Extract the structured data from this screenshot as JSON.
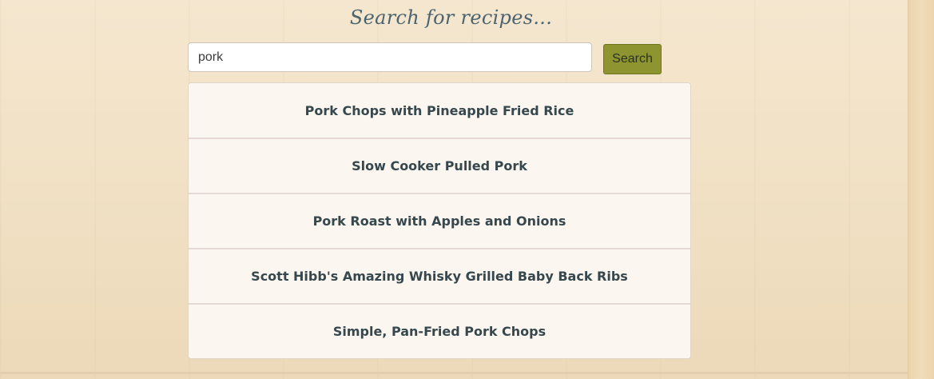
{
  "heading": "Search for recipes...",
  "search": {
    "value": "pork",
    "button_label": "Search"
  },
  "results": [
    {
      "title": "Pork Chops with Pineapple Fried Rice"
    },
    {
      "title": "Slow Cooker Pulled Pork"
    },
    {
      "title": "Pork Roast with Apples and Onions"
    },
    {
      "title": "Scott Hibb's Amazing Whisky Grilled Baby Back Ribs"
    },
    {
      "title": "Simple, Pan-Fried Pork Chops"
    }
  ],
  "colors": {
    "heading": "#4b6470",
    "button": "#8d9430",
    "result_text": "#36474d",
    "result_background": "#fbf7f0"
  }
}
